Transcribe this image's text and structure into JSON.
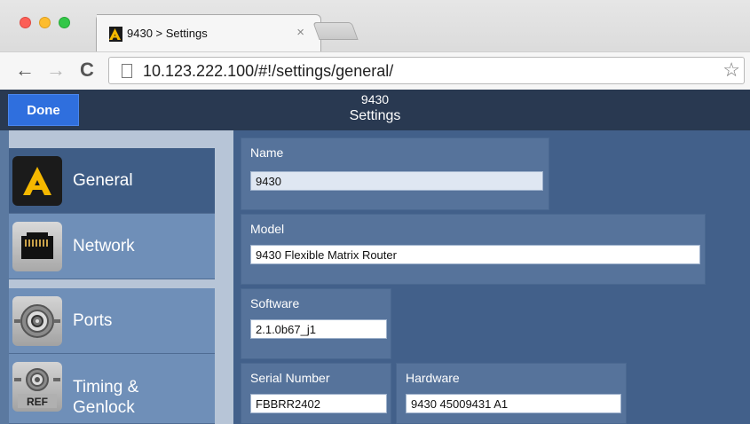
{
  "browser": {
    "tab_title": "9430 > Settings",
    "tab_close": "×",
    "url": "10.123.222.100/#!/settings/general/",
    "back_glyph": "←",
    "forward_glyph": "→",
    "reload_glyph": "C",
    "star_glyph": "☆"
  },
  "header": {
    "done_label": "Done",
    "title_line1": "9430",
    "title_line2": "Settings"
  },
  "sidebar": {
    "items": [
      {
        "label": "General",
        "icon": "general-logo-icon",
        "active": true
      },
      {
        "label": "Network",
        "icon": "ethernet-port-icon",
        "active": false
      },
      {
        "label": "Ports",
        "icon": "bnc-connector-icon",
        "active": false
      },
      {
        "label_line1": "Timing &",
        "label_line2": "Genlock",
        "icon": "ref-connector-icon",
        "icon_text": "REF",
        "active": false
      }
    ]
  },
  "main": {
    "name": {
      "label": "Name",
      "value": "9430"
    },
    "model": {
      "label": "Model",
      "value": "9430 Flexible Matrix Router"
    },
    "software": {
      "label": "Software",
      "value": "2.1.0b67_j1"
    },
    "serial": {
      "label": "Serial Number",
      "value": "FBBRR2402"
    },
    "hardware": {
      "label": "Hardware",
      "value": "9430 45009431 A1"
    }
  },
  "colors": {
    "header_bg": "#293951",
    "done_button": "#2f6fde",
    "sidebar_active": "#3f5d86",
    "main_bg": "#42608a",
    "accent_logo": "#f5b800"
  }
}
